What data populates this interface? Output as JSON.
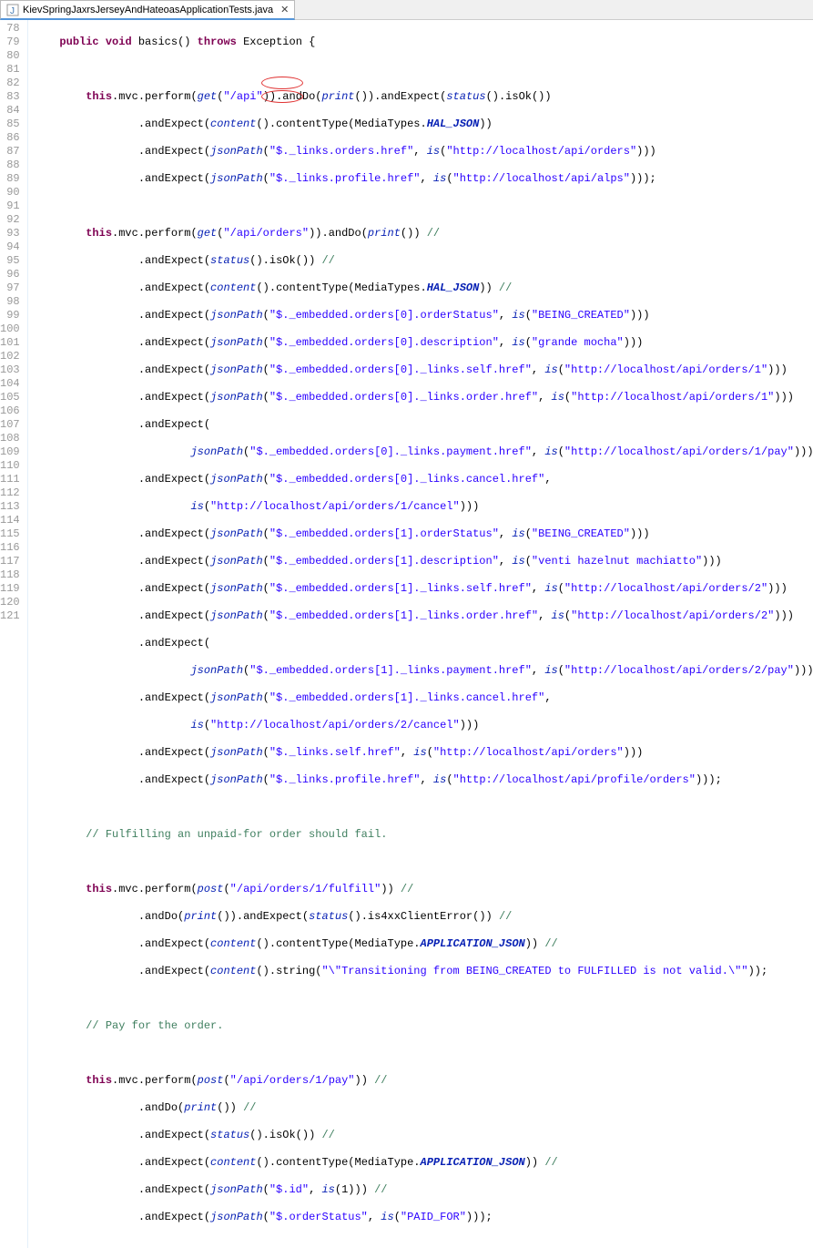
{
  "tab": {
    "label": "KievSpringJaxrsJerseyAndHateoasApplicationTests.java",
    "close": "✕"
  },
  "line_numbers": [
    "78",
    "79",
    "80",
    "81",
    "82",
    "83",
    "84",
    "85",
    "86",
    "87",
    "88",
    "89",
    "90",
    "91",
    "92",
    "93",
    "94",
    "95",
    "96",
    "97",
    "98",
    "99",
    "100",
    "101",
    "102",
    "103",
    "104",
    "105",
    "106",
    "107",
    "108",
    "109",
    "110",
    "111",
    "112",
    "113",
    "114",
    "115",
    "116",
    "117",
    "118",
    "119",
    "120",
    "121"
  ],
  "code": {
    "l78": {
      "kw1": "public",
      "kw2": "void",
      "m": " basics() ",
      "kw3": "throws",
      "r": " Exception {"
    },
    "l80": {
      "p1": "this",
      "p2": ".mvc.perform(",
      "p3": "get",
      "p4": "(",
      "s1": "\"/api\"",
      "p5": ")).andDo(",
      "p6": "print",
      "p7": "()).andExpect(",
      "p8": "status",
      "p9": "().isOk())"
    },
    "l81": {
      "p1": ".andExpect(",
      "p2": "content",
      "p3": "().contentType(MediaTypes.",
      "p4": "HAL_JSON",
      "p5": "))"
    },
    "l82": {
      "p1": ".andExpect(",
      "p2": "jsonPath",
      "p3": "(",
      "s1": "\"$._links.orders.href\"",
      "p4": ", ",
      "p5": "is",
      "p6": "(",
      "s2": "\"http://localhost/api/orders\"",
      "p7": ")))"
    },
    "l83": {
      "p1": ".andExpect(",
      "p2": "jsonPath",
      "p3": "(",
      "s1": "\"$._links.profile.href\"",
      "p4": ", ",
      "p5": "is",
      "p6": "(",
      "s2": "\"http://localhost/api/alps\"",
      "p7": ")));"
    },
    "l85": {
      "p1": "this",
      "p2": ".mvc.perform(",
      "p3": "get",
      "p4": "(",
      "s1": "\"/api/orders\"",
      "p5": ")).andDo(",
      "p6": "print",
      "p7": "()) ",
      "c": "//"
    },
    "l86": {
      "p1": ".andExpect(",
      "p2": "status",
      "p3": "().isOk()) ",
      "c": "//"
    },
    "l87": {
      "p1": ".andExpect(",
      "p2": "content",
      "p3": "().contentType(MediaTypes.",
      "p4": "HAL_JSON",
      "p5": ")) ",
      "c": "//"
    },
    "l88": {
      "p1": ".andExpect(",
      "p2": "jsonPath",
      "p3": "(",
      "s1": "\"$._embedded.orders[0].orderStatus\"",
      "p4": ", ",
      "p5": "is",
      "p6": "(",
      "s2": "\"BEING_CREATED\"",
      "p7": ")))"
    },
    "l89": {
      "p1": ".andExpect(",
      "p2": "jsonPath",
      "p3": "(",
      "s1": "\"$._embedded.orders[0].description\"",
      "p4": ", ",
      "p5": "is",
      "p6": "(",
      "s2": "\"grande mocha\"",
      "p7": ")))"
    },
    "l90": {
      "p1": ".andExpect(",
      "p2": "jsonPath",
      "p3": "(",
      "s1": "\"$._embedded.orders[0]._links.self.href\"",
      "p4": ", ",
      "p5": "is",
      "p6": "(",
      "s2": "\"http://localhost/api/orders/1\"",
      "p7": ")))"
    },
    "l91": {
      "p1": ".andExpect(",
      "p2": "jsonPath",
      "p3": "(",
      "s1": "\"$._embedded.orders[0]._links.order.href\"",
      "p4": ", ",
      "p5": "is",
      "p6": "(",
      "s2": "\"http://localhost/api/orders/1\"",
      "p7": ")))"
    },
    "l92": {
      "p1": ".andExpect("
    },
    "l93": {
      "p2": "jsonPath",
      "p3": "(",
      "s1": "\"$._embedded.orders[0]._links.payment.href\"",
      "p4": ", ",
      "p5": "is",
      "p6": "(",
      "s2": "\"http://localhost/api/orders/1/pay\"",
      "p7": ")))"
    },
    "l94": {
      "p1": ".andExpect(",
      "p2": "jsonPath",
      "p3": "(",
      "s1": "\"$._embedded.orders[0]._links.cancel.href\"",
      "p4": ","
    },
    "l95": {
      "p5": "is",
      "p6": "(",
      "s2": "\"http://localhost/api/orders/1/cancel\"",
      "p7": ")))"
    },
    "l96": {
      "p1": ".andExpect(",
      "p2": "jsonPath",
      "p3": "(",
      "s1": "\"$._embedded.orders[1].orderStatus\"",
      "p4": ", ",
      "p5": "is",
      "p6": "(",
      "s2": "\"BEING_CREATED\"",
      "p7": ")))"
    },
    "l97": {
      "p1": ".andExpect(",
      "p2": "jsonPath",
      "p3": "(",
      "s1": "\"$._embedded.orders[1].description\"",
      "p4": ", ",
      "p5": "is",
      "p6": "(",
      "s2": "\"venti hazelnut machiatto\"",
      "p7": ")))"
    },
    "l98": {
      "p1": ".andExpect(",
      "p2": "jsonPath",
      "p3": "(",
      "s1": "\"$._embedded.orders[1]._links.self.href\"",
      "p4": ", ",
      "p5": "is",
      "p6": "(",
      "s2": "\"http://localhost/api/orders/2\"",
      "p7": ")))"
    },
    "l99": {
      "p1": ".andExpect(",
      "p2": "jsonPath",
      "p3": "(",
      "s1": "\"$._embedded.orders[1]._links.order.href\"",
      "p4": ", ",
      "p5": "is",
      "p6": "(",
      "s2": "\"http://localhost/api/orders/2\"",
      "p7": ")))"
    },
    "l100": {
      "p1": ".andExpect("
    },
    "l101": {
      "p2": "jsonPath",
      "p3": "(",
      "s1": "\"$._embedded.orders[1]._links.payment.href\"",
      "p4": ", ",
      "p5": "is",
      "p6": "(",
      "s2": "\"http://localhost/api/orders/2/pay\"",
      "p7": ")))"
    },
    "l102": {
      "p1": ".andExpect(",
      "p2": "jsonPath",
      "p3": "(",
      "s1": "\"$._embedded.orders[1]._links.cancel.href\"",
      "p4": ","
    },
    "l103": {
      "p5": "is",
      "p6": "(",
      "s2": "\"http://localhost/api/orders/2/cancel\"",
      "p7": ")))"
    },
    "l104": {
      "p1": ".andExpect(",
      "p2": "jsonPath",
      "p3": "(",
      "s1": "\"$._links.self.href\"",
      "p4": ", ",
      "p5": "is",
      "p6": "(",
      "s2": "\"http://localhost/api/orders\"",
      "p7": ")))"
    },
    "l105": {
      "p1": ".andExpect(",
      "p2": "jsonPath",
      "p3": "(",
      "s1": "\"$._links.profile.href\"",
      "p4": ", ",
      "p5": "is",
      "p6": "(",
      "s2": "\"http://localhost/api/profile/orders\"",
      "p7": ")));"
    },
    "l107": {
      "c": "// Fulfilling an unpaid-for order should fail."
    },
    "l109": {
      "p1": "this",
      "p2": ".mvc.perform(",
      "p3": "post",
      "p4": "(",
      "s1": "\"/api/orders/1/fulfill\"",
      "p5": ")) ",
      "c": "//"
    },
    "l110": {
      "p1": ".andDo(",
      "p2": "print",
      "p3": "()).andExpect(",
      "p4": "status",
      "p5": "().is4xxClientError()) ",
      "c": "//"
    },
    "l111": {
      "p1": ".andExpect(",
      "p2": "content",
      "p3": "().contentType(MediaType.",
      "p4": "APPLICATION_JSON",
      "p5": ")) ",
      "c": "//"
    },
    "l112": {
      "p1": ".andExpect(",
      "p2": "content",
      "p3": "().string(",
      "s1": "\"\\\"Transitioning from BEING_CREATED to FULFILLED is not valid.\\\"\"",
      "p4": "));"
    },
    "l114": {
      "c": "// Pay for the order."
    },
    "l116": {
      "p1": "this",
      "p2": ".mvc.perform(",
      "p3": "post",
      "p4": "(",
      "s1": "\"/api/orders/1/pay\"",
      "p5": ")) ",
      "c": "//"
    },
    "l117": {
      "p1": ".andDo(",
      "p2": "print",
      "p3": "()) ",
      "c": "//"
    },
    "l118": {
      "p1": ".andExpect(",
      "p2": "status",
      "p3": "().isOk()) ",
      "c": "//"
    },
    "l119": {
      "p1": ".andExpect(",
      "p2": "content",
      "p3": "().contentType(MediaType.",
      "p4": "APPLICATION_JSON",
      "p5": ")) ",
      "c": "//"
    },
    "l120": {
      "p1": ".andExpect(",
      "p2": "jsonPath",
      "p3": "(",
      "s1": "\"$.id\"",
      "p4": ", ",
      "p5": "is",
      "p6": "(1))) ",
      "c": "//"
    },
    "l121": {
      "p1": ".andExpect(",
      "p2": "jsonPath",
      "p3": "(",
      "s1": "\"$.orderStatus\"",
      "p4": ", ",
      "p5": "is",
      "p6": "(",
      "s2": "\"PAID_FOR\"",
      "p7": ")));"
    }
  },
  "indents": {
    "i1": "    ",
    "i2": "        ",
    "i3": "                ",
    "i4": "                        "
  }
}
